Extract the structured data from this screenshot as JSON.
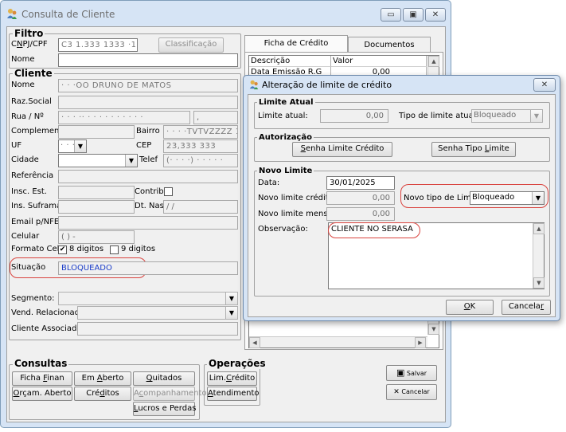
{
  "main_window": {
    "title": "Consulta de Cliente",
    "controls": {
      "minimize": "▭",
      "maximize": "▣",
      "close": "✕"
    }
  },
  "filtro": {
    "title": "Filtro",
    "cnpj_label_pre": "C",
    "cnpj_label_u": "N",
    "cnpj_label_post": "PJ/CPF",
    "cnpj_value": "C3 1.333 1333 ·13",
    "classificacao_button": "Classificação",
    "nome_label": "Nome"
  },
  "cliente": {
    "title": "Cliente",
    "nome_label": "Nome",
    "nome_value": "· · ·OO DRUNO DE MATOS",
    "razao_social_label": "Raz.Social",
    "rua_label": "Rua / Nº",
    "rua_value": "· · · ·· · · · · · · · · · ·",
    "rua_comma": ",",
    "complement_label": "Complement",
    "bairro_label": "Bairro",
    "bairro_value": "· · · ·TVTVZZZZ 1",
    "uf_label": "UF",
    "uf_value": "· · ·",
    "cep_label": "CEP",
    "cep_value": "23,333 333",
    "cidade_label": "Cidade",
    "telef_label": "Telef",
    "telef_value": "(· · · ·) · · · · ·",
    "referencia_label": "Referência",
    "insc_est_label": "Insc. Est.",
    "contrib_label": "Contrib:",
    "ins_suframa_label": "Ins. Suframa",
    "dt_nas_label": "Dt. Nas.",
    "dt_nas_value": "/ /",
    "email_label": "Email p/NFE",
    "celular_label": "Celular",
    "celular_value": "( ) -",
    "formato_cel_label": "Formato Cel:",
    "opt_8": "8 digitos",
    "opt_9": "9 digitos",
    "check_mark": "✔",
    "situacao_label": "Situação",
    "situacao_value": "BLOQUEADO",
    "segmento_label": "Segmento:",
    "vend_label": "Vend. Relacionado:",
    "cliente_assoc_label": "Cliente Associado:",
    "arrow": "▼"
  },
  "tabs": {
    "ficha": "Ficha de Crédito",
    "documentos": "Documentos"
  },
  "grid": {
    "headers": [
      "Descrição",
      "Valor"
    ],
    "rows": [
      [
        "Data Emissão R.G",
        "0,00"
      ]
    ],
    "up": "▲",
    "down": "▼",
    "left": "◀",
    "right": "▶"
  },
  "consultas": {
    "title": "Consultas",
    "ficha_finan_pre": "Ficha ",
    "ficha_finan_u": "F",
    "ficha_finan_post": "inan",
    "em_aberto_pre": "Em ",
    "em_aberto_u": "A",
    "em_aberto_post": "berto",
    "quitados_u": "Q",
    "quitados_post": "uitados",
    "orcam_u": "O",
    "orcam_post": "rçam. Aberto",
    "creditos_pre": "Cré",
    "creditos_u": "d",
    "creditos_post": "itos",
    "acomp_pre": "A",
    "acomp_u": "c",
    "acomp_post": "ompanhamento",
    "lucros_u": "L",
    "lucros_post": "ucros e Perdas"
  },
  "operacoes": {
    "title": "Operações",
    "lim_pre": "Lim.",
    "lim_u": "C",
    "lim_post": "rédito",
    "atend_u": "A",
    "atend_post": "tendimento"
  },
  "actions": {
    "salvar": "Salvar",
    "cancelar": "Cancelar",
    "save_icon": "▣",
    "cancel_icon": "✕"
  },
  "dialog": {
    "title": "Alteração de limite de crédito",
    "close": "✕",
    "limite_atual_title": "Limite Atual",
    "limite_atual_label": "Limite atual:",
    "limite_atual_value": "0,00",
    "tipo_atual_label": "Tipo de limite atual:",
    "tipo_atual_value": "Bloqueado",
    "autorizacao_title": "Autorização",
    "senha_limite_u": "S",
    "senha_limite_post": "enha Limite Crédito",
    "senha_tipo_pre": "Senha Tipo ",
    "senha_tipo_u": "L",
    "senha_tipo_post": "imite",
    "novo_limite_title": "Novo Limite",
    "data_label": "Data:",
    "data_value": "30/01/2025",
    "novo_limite_label": "Novo limite crédito:",
    "novo_limite_value": "0,00",
    "novo_tipo_label": "Novo tipo de Limite:",
    "novo_tipo_value": "Bloqueado",
    "novo_mensal_label": "Novo limite mensal:",
    "novo_mensal_value": "0,00",
    "observacao_label": "Observação:",
    "observacao_value": "CLIENTE NO SERASA",
    "ok_u": "O",
    "ok_post": "K",
    "cancel_pre": "Cancela",
    "cancel_u": "r"
  }
}
